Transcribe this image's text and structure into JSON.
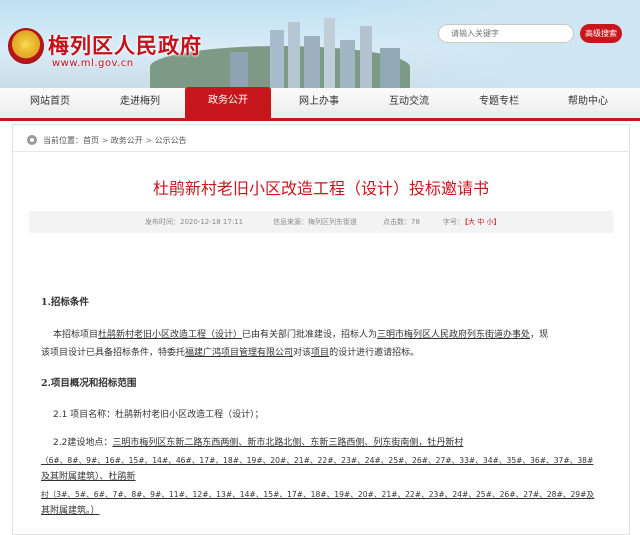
{
  "header": {
    "site_title": "梅列区人民政府",
    "site_url": "www.ml.gov.cn",
    "search_placeholder": "请输入关键字",
    "advanced_search": "高级搜索"
  },
  "nav": {
    "items": [
      "网站首页",
      "走进梅列",
      "政务公开",
      "网上办事",
      "互动交流",
      "专题专栏",
      "帮助中心"
    ],
    "active": "政务公开"
  },
  "breadcrumb": {
    "prefix": "当前位置：",
    "items": [
      "首页",
      "政务公开",
      "公示公告"
    ],
    "separator": ">"
  },
  "article": {
    "title": "杜鹃新村老旧小区改造工程（设计）投标邀请书",
    "meta": {
      "publish_time": "发布时间：2020-12-18 17:11",
      "source": "信息来源：梅列区列东街道",
      "views": "点击数：78",
      "font_size_label": "字号：",
      "font_size_options": "【大 中 小】"
    },
    "sections": {
      "s1_heading": "1.招标条件",
      "s1_p1_a": "本招标项目",
      "s1_p1_u1": "杜鹃新村老旧小区改造工程（设计）",
      "s1_p1_b": "已由有关部门批准建设，招标人为",
      "s1_p1_u2": "三明市梅列区人民政府列东街道办事处",
      "s1_p1_c": "，现",
      "s1_p2_a": "该项目设计已具备招标条件，特委托",
      "s1_p2_u1": "福建广鸿项目管理有限公司",
      "s1_p2_b": "对该",
      "s1_p2_u2": "项目",
      "s1_p2_c": "的设计进行邀请招标。",
      "s2_heading": "2.项目概况和招标范围",
      "s2_1": "2.1 项目名称：杜鹃新村老旧小区改造工程（设计）；",
      "s2_2_a": "2.2建设地点：",
      "s2_2_line1": "三明市梅列区东新二路东西两侧、新市北路北侧、东新三路西侧、列东街南侧，牡丹新村",
      "s2_2_line2": "（6#、8#、9#、16#、15#、14#、46#、17#、18#、19#、20#、21#、22#、23#、24#、25#、26#、27#、33#、34#、35#、36#、37#、38#",
      "s2_2_line3": "及其附属建筑）、杜鹃新",
      "s2_2_line4": "村（3#、5#、6#、7#、8#、9#、11#、12#、13#、14#、15#、17#、18#、19#、20#、21#、22#、23#、24#、25#、26#、27#、28#、29#及",
      "s2_2_line5": "其附属建筑。）"
    }
  },
  "colors": {
    "brand_red": "#c8161d",
    "nav_bg": "#ececec",
    "meta_bg": "#f3f3f3"
  }
}
